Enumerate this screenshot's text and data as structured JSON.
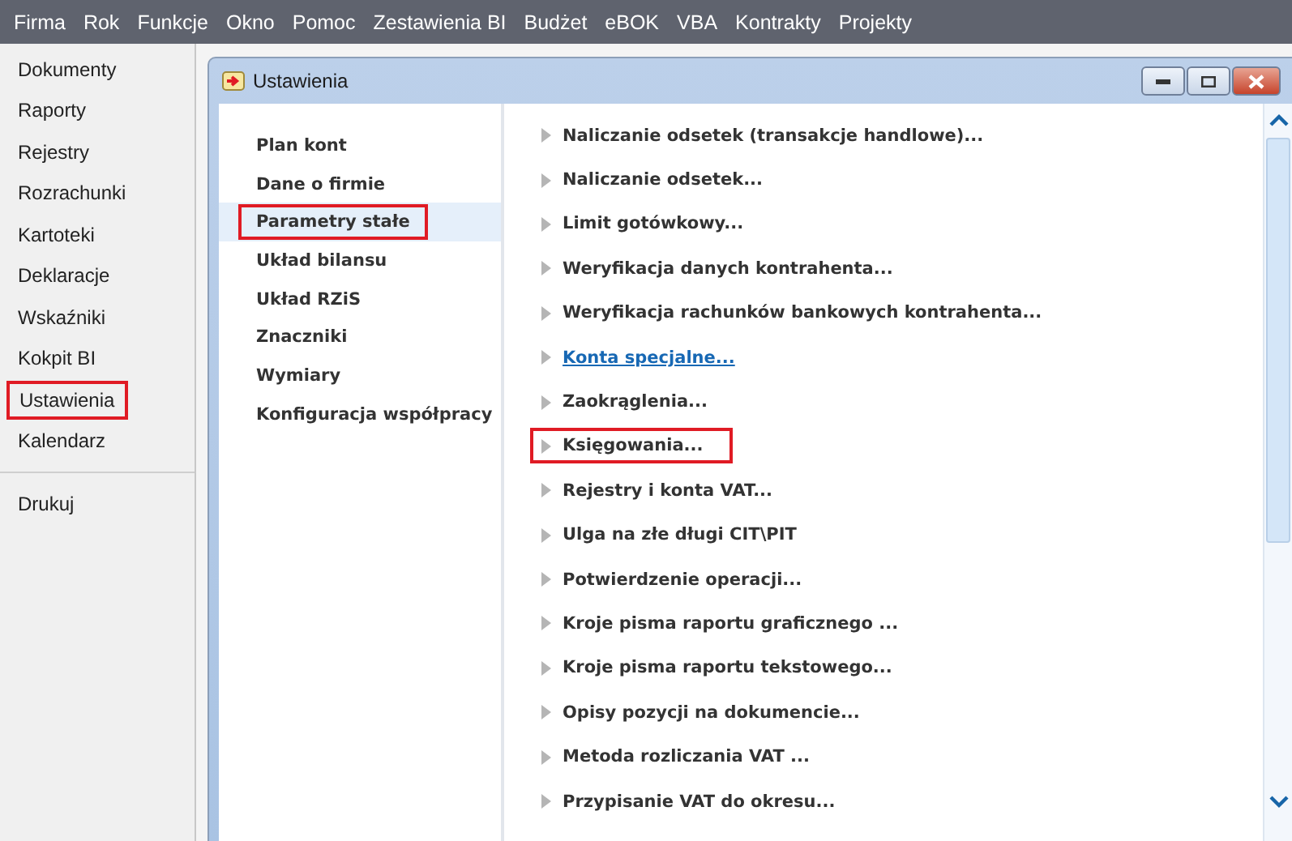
{
  "menu_bar": [
    "Firma",
    "Rok",
    "Funkcje",
    "Okno",
    "Pomoc",
    "Zestawienia BI",
    "Budżet",
    "eBOK",
    "VBA",
    "Kontrakty",
    "Projekty"
  ],
  "sidebar": {
    "items": [
      {
        "label": "Dokumenty",
        "highlighted": false
      },
      {
        "label": "Raporty",
        "highlighted": false
      },
      {
        "label": "Rejestry",
        "highlighted": false
      },
      {
        "label": "Rozrachunki",
        "highlighted": false
      },
      {
        "label": "Kartoteki",
        "highlighted": false
      },
      {
        "label": "Deklaracje",
        "highlighted": false
      },
      {
        "label": "Wskaźniki",
        "highlighted": false
      },
      {
        "label": "Kokpit BI",
        "highlighted": false
      },
      {
        "label": "Ustawienia",
        "highlighted": true
      },
      {
        "label": "Kalendarz",
        "highlighted": false
      }
    ],
    "footer_items": [
      "Drukuj"
    ]
  },
  "window": {
    "title": "Ustawienia",
    "categories": [
      {
        "label": "Plan kont",
        "selected": false,
        "highlighted": false
      },
      {
        "label": "Dane o firmie",
        "selected": false,
        "highlighted": false
      },
      {
        "label": "Parametry stałe",
        "selected": true,
        "highlighted": true
      },
      {
        "label": "Układ bilansu",
        "selected": false,
        "highlighted": false
      },
      {
        "label": "Układ RZiS",
        "selected": false,
        "highlighted": false
      },
      {
        "label": "Znaczniki",
        "selected": false,
        "highlighted": false
      },
      {
        "label": "Wymiary",
        "selected": false,
        "highlighted": false
      },
      {
        "label": "Konfiguracja współpracy",
        "selected": false,
        "highlighted": false
      }
    ],
    "settings": [
      {
        "label": "Naliczanie odsetek (transakcje handlowe)...",
        "hovered": false,
        "highlighted": false
      },
      {
        "label": "Naliczanie odsetek...",
        "hovered": false,
        "highlighted": false
      },
      {
        "label": "Limit gotówkowy...",
        "hovered": false,
        "highlighted": false
      },
      {
        "label": "Weryfikacja danych kontrahenta...",
        "hovered": false,
        "highlighted": false
      },
      {
        "label": "Weryfikacja rachunków bankowych kontrahenta...",
        "hovered": false,
        "highlighted": false
      },
      {
        "label": "Konta specjalne...",
        "hovered": true,
        "highlighted": false
      },
      {
        "label": "Zaokrąglenia...",
        "hovered": false,
        "highlighted": false
      },
      {
        "label": "Księgowania...",
        "hovered": false,
        "highlighted": true
      },
      {
        "label": "Rejestry i konta VAT...",
        "hovered": false,
        "highlighted": false
      },
      {
        "label": "Ulga na złe długi CIT\\PIT",
        "hovered": false,
        "highlighted": false
      },
      {
        "label": "Potwierdzenie operacji...",
        "hovered": false,
        "highlighted": false
      },
      {
        "label": "Kroje pisma raportu graficznego ...",
        "hovered": false,
        "highlighted": false
      },
      {
        "label": "Kroje pisma raportu tekstowego...",
        "hovered": false,
        "highlighted": false
      },
      {
        "label": "Opisy pozycji na dokumencie...",
        "hovered": false,
        "highlighted": false
      },
      {
        "label": "Metoda rozliczania VAT ...",
        "hovered": false,
        "highlighted": false
      },
      {
        "label": "Przypisanie VAT do okresu...",
        "hovered": false,
        "highlighted": false
      }
    ]
  }
}
